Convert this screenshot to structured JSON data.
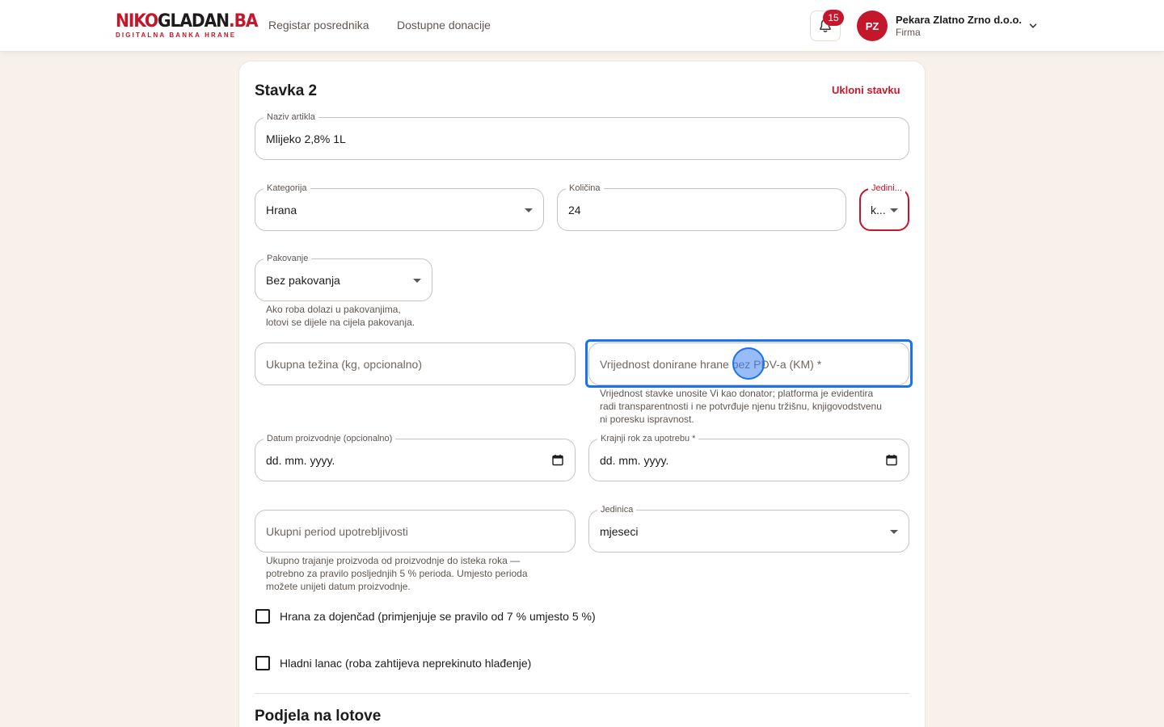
{
  "header": {
    "logo_red": "NIKO",
    "logo_dark": "GLADAN",
    "logo_tld": ".BA",
    "logo_subtitle": "DIGITALNA BANKA HRANE",
    "nav": [
      "Registar posrednika",
      "Dostupne donacije"
    ],
    "notifications_count": "15",
    "user_initials": "PZ",
    "user_name": "Pekara Zlatno Zrno d.o.o.",
    "user_role": "Firma"
  },
  "item": {
    "title": "Stavka 2",
    "remove_label": "Ukloni stavku",
    "name_label": "Naziv artikla",
    "name_value": "Mlijeko 2,8% 1L",
    "category_label": "Kategorija",
    "category_value": "Hrana",
    "quantity_label": "Količina",
    "quantity_value": "24",
    "unit_label": "Jedini...",
    "unit_value": "k...",
    "packaging_label": "Pakovanje",
    "packaging_value": "Bez pakovanja",
    "packaging_help_1": "Ako roba dolazi u pakovanjima,",
    "packaging_help_2": "lotovi se dijele na cijela pakovanja.",
    "weight_placeholder": "Ukupna težina (kg, opcionalno)",
    "value_placeholder": "Vrijednost donirane hrane bez PDV-a (KM) *",
    "value_help_1": "Vrijednost stavke unosite Vi kao donator; platforma je evidentira",
    "value_help_2": "radi transparentnosti i ne potvrđuje njenu tržišnu, knjigovodstvenu",
    "value_help_3": "ni poresku ispravnost.",
    "production_label": "Datum proizvodnje (opcionalno)",
    "production_value": "dd. mm. yyyy.",
    "expiry_label": "Krajnji rok za upotrebu *",
    "expiry_value": "dd. mm. yyyy.",
    "shelf_placeholder": "Ukupni period upotrebljivosti",
    "shelf_unit_label": "Jedinica",
    "shelf_unit_value": "mjeseci",
    "shelf_help_1": "Ukupno trajanje proizvoda od proizvodnje do isteka roka —",
    "shelf_help_2": "potrebno za pravilo posljednjih 5 % perioda. Umjesto perioda",
    "shelf_help_3": "možete unijeti datum proizvodnje.",
    "infant_label": "Hrana za dojenčad (primjenjuje se pravilo od 7 % umjesto 5 %)",
    "cold_chain_label": "Hladni lanac (roba zahtijeva neprekinuto hlađenje)"
  },
  "lots": {
    "title": "Podjela na lotove"
  },
  "colors": {
    "brand_red": "#c4172c",
    "focus_blue": "#1a73e8",
    "page_background": "#f7f1e9"
  }
}
